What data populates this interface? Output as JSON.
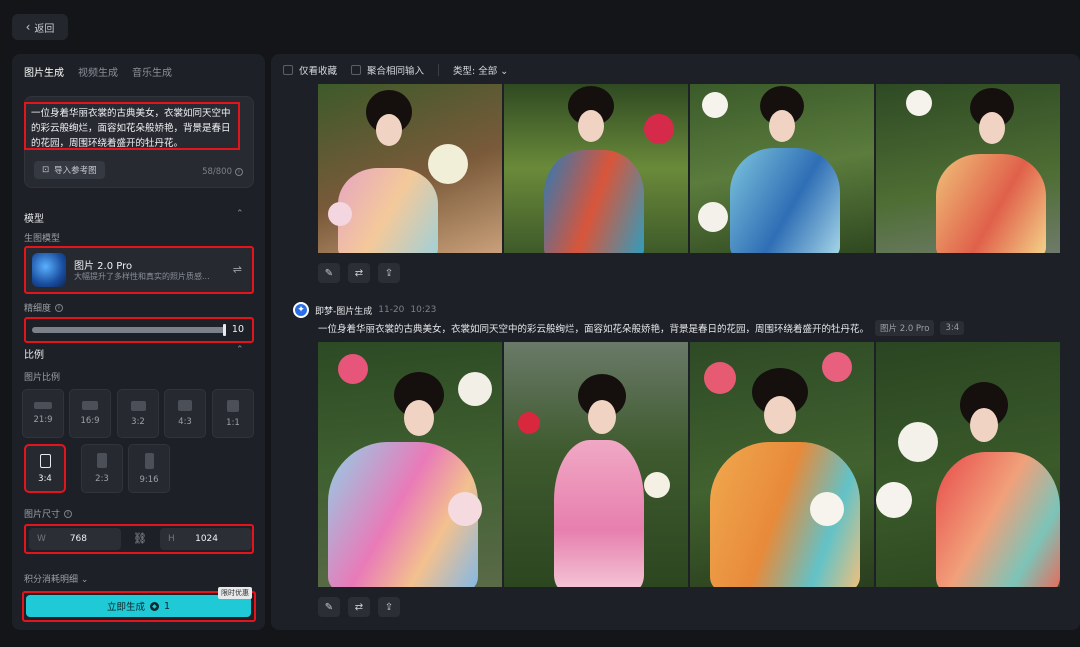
{
  "back": {
    "label": "返回"
  },
  "left": {
    "tabs": [
      {
        "label": "图片生成",
        "active": true
      },
      {
        "label": "视频生成",
        "active": false
      },
      {
        "label": "音乐生成",
        "active": false
      }
    ],
    "prompt": "一位身着华丽衣裳的古典美女，衣裳如同天空中的彩云般绚烂，面容如花朵般娇艳，背景是春日的花园，周围环绕着盛开的牡丹花。",
    "ref_button": "导入参考图",
    "char_count": "58/800",
    "model_section": "模型",
    "model_sub": "生图模型",
    "model_name": "图片 2.0 Pro",
    "model_desc": "大幅提升了多样性和真实的照片质感...",
    "fineness_label": "精细度",
    "fineness_value": "10",
    "fineness_level": 1.0,
    "ratio_section": "比例",
    "ratio_sub": "图片比例",
    "ratios": [
      "21:9",
      "16:9",
      "3:2",
      "4:3",
      "1:1",
      "3:4",
      "2:3",
      "9:16"
    ],
    "selected_ratio": "3:4",
    "size_label": "图片尺寸",
    "width_key": "W",
    "width_value": "768",
    "height_key": "H",
    "height_value": "1024",
    "cost_label": "积分消耗明细",
    "generate_label": "立即生成",
    "generate_cost": "1",
    "promo": "限时优惠"
  },
  "main": {
    "filters": {
      "favorites": "仅看收藏",
      "merge": "聚合相同输入",
      "type": "类型: 全部"
    },
    "message": {
      "author": "即梦-图片生成",
      "date": "11-20",
      "time": "10:23",
      "prompt": "一位身着华丽衣裳的古典美女，衣裳如同天空中的彩云般绚烂，面容如花朵般娇艳，背景是春日的花园，周围环绕着盛开的牡丹花。",
      "model_tag": "图片 2.0 Pro",
      "ratio_tag": "3:4"
    }
  },
  "colors": {
    "accent": "#1fc9d6",
    "highlight": "#e4141d",
    "panel": "#1d2026",
    "background": "#131519"
  },
  "icons": [
    "chevron-left-icon",
    "image-import-icon",
    "info-icon",
    "chevron-up-icon",
    "settings-sliders-icon",
    "link-icon",
    "chevron-down-icon",
    "coin-icon",
    "edit-icon",
    "regenerate-icon",
    "upload-icon",
    "jimeng-logo-icon"
  ]
}
